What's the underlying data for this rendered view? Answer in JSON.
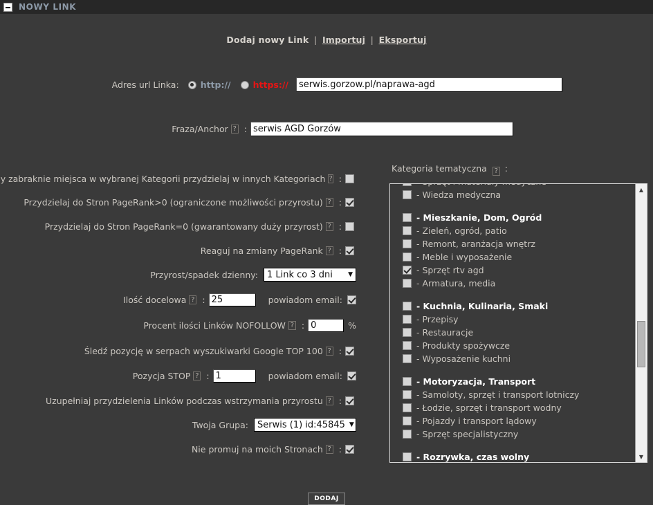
{
  "titlebar": {
    "title": "NOWY LINK",
    "collapse_icon": "minus-box-icon"
  },
  "toplinks": {
    "current": "Dodaj nowy Link",
    "sep1": "|",
    "import": "Importuj",
    "sep2": "|",
    "export": "Eksportuj"
  },
  "url_row": {
    "label": "Adres url Linka:",
    "http_label": "http://",
    "https_label": "https://",
    "http_selected": true,
    "https_selected": false,
    "value": "serwis.gorzow.pl/naprawa-agd",
    "https_color": "#e81414",
    "http_color": "#8d9aa8"
  },
  "anchor_row": {
    "label": "Fraza/Anchor",
    "help": "?",
    "colon": ":",
    "value": "serwis AGD Gorzów"
  },
  "options": [
    {
      "label": "Gdy zabraknie miejsca w wybranej Kategorii przydzielaj w innych Kategoriach",
      "checked": false
    },
    {
      "label": "Przydzielaj do Stron PageRank>0 (ograniczone możliwości przyrostu)",
      "checked": true
    },
    {
      "label": "Przydzielaj do Stron PageRank=0 (gwarantowany duży przyrost)",
      "checked": false
    },
    {
      "label": "Reaguj na zmiany PageRank",
      "checked": true
    }
  ],
  "growth_row": {
    "label": "Przyrost/spadek dzienny:",
    "value": "1 Link co 3 dni",
    "arrow": "▼"
  },
  "target_row": {
    "label": "Ilość docelowa",
    "help": "?",
    "colon": ":",
    "value": "25",
    "email_label": "powiadom email:",
    "email_checked": true
  },
  "nofollow_row": {
    "label": "Procent ilości Linków NOFOLLOW",
    "help": "?",
    "colon": ":",
    "value": "0",
    "suffix": "%"
  },
  "serp_row": {
    "label": "Śledź pozycję w serpach wyszukiwarki Google TOP 100",
    "checked": true
  },
  "stop_row": {
    "label": "Pozycja STOP",
    "help": "?",
    "colon": ":",
    "value": "1",
    "email_label": "powiadom email:",
    "email_checked": true
  },
  "refill_row": {
    "label": "Uzupełniaj przydzielenia Linków podczas wstrzymania przyrostu",
    "checked": true
  },
  "group_row": {
    "label": "Twoja Grupa:",
    "value": "Serwis (1)    id:45845",
    "arrow": "▼"
  },
  "nopromo_row": {
    "label": "Nie promuj na moich Stronach",
    "checked": true
  },
  "category": {
    "label": "Kategoria tematyczna",
    "help": "?",
    "colon": ":",
    "scroll_up": "▲",
    "scroll_down": "▼",
    "items": [
      {
        "label": "- Sprzęt i materiały medyczne",
        "checked": false,
        "heading": false,
        "gap_before": false
      },
      {
        "label": "- Wiedza medyczna",
        "checked": false,
        "heading": false,
        "gap_before": false
      },
      {
        "label": "- Mieszkanie, Dom, Ogród",
        "checked": false,
        "heading": true,
        "gap_before": true
      },
      {
        "label": "- Zieleń, ogród, patio",
        "checked": false,
        "heading": false,
        "gap_before": false
      },
      {
        "label": "- Remont, aranżacja wnętrz",
        "checked": false,
        "heading": false,
        "gap_before": false
      },
      {
        "label": "- Meble i wyposażenie",
        "checked": false,
        "heading": false,
        "gap_before": false
      },
      {
        "label": "- Sprzęt rtv agd",
        "checked": true,
        "heading": false,
        "gap_before": false
      },
      {
        "label": "- Armatura, media",
        "checked": false,
        "heading": false,
        "gap_before": false
      },
      {
        "label": "- Kuchnia, Kulinaria, Smaki",
        "checked": false,
        "heading": true,
        "gap_before": true
      },
      {
        "label": "- Przepisy",
        "checked": false,
        "heading": false,
        "gap_before": false
      },
      {
        "label": "- Restauracje",
        "checked": false,
        "heading": false,
        "gap_before": false
      },
      {
        "label": "- Produkty spożywcze",
        "checked": false,
        "heading": false,
        "gap_before": false
      },
      {
        "label": "- Wyposażenie kuchni",
        "checked": false,
        "heading": false,
        "gap_before": false
      },
      {
        "label": "- Motoryzacja, Transport",
        "checked": false,
        "heading": true,
        "gap_before": true
      },
      {
        "label": "- Samoloty, sprzęt i transport lotniczy",
        "checked": false,
        "heading": false,
        "gap_before": false
      },
      {
        "label": "- Łodzie, sprzęt i transport wodny",
        "checked": false,
        "heading": false,
        "gap_before": false
      },
      {
        "label": "- Pojazdy i transport lądowy",
        "checked": false,
        "heading": false,
        "gap_before": false
      },
      {
        "label": "- Sprzęt specjalistyczny",
        "checked": false,
        "heading": false,
        "gap_before": false
      },
      {
        "label": "- Rozrywka, czas wolny",
        "checked": false,
        "heading": true,
        "gap_before": true
      }
    ]
  },
  "submit": {
    "label": "DODAJ"
  }
}
